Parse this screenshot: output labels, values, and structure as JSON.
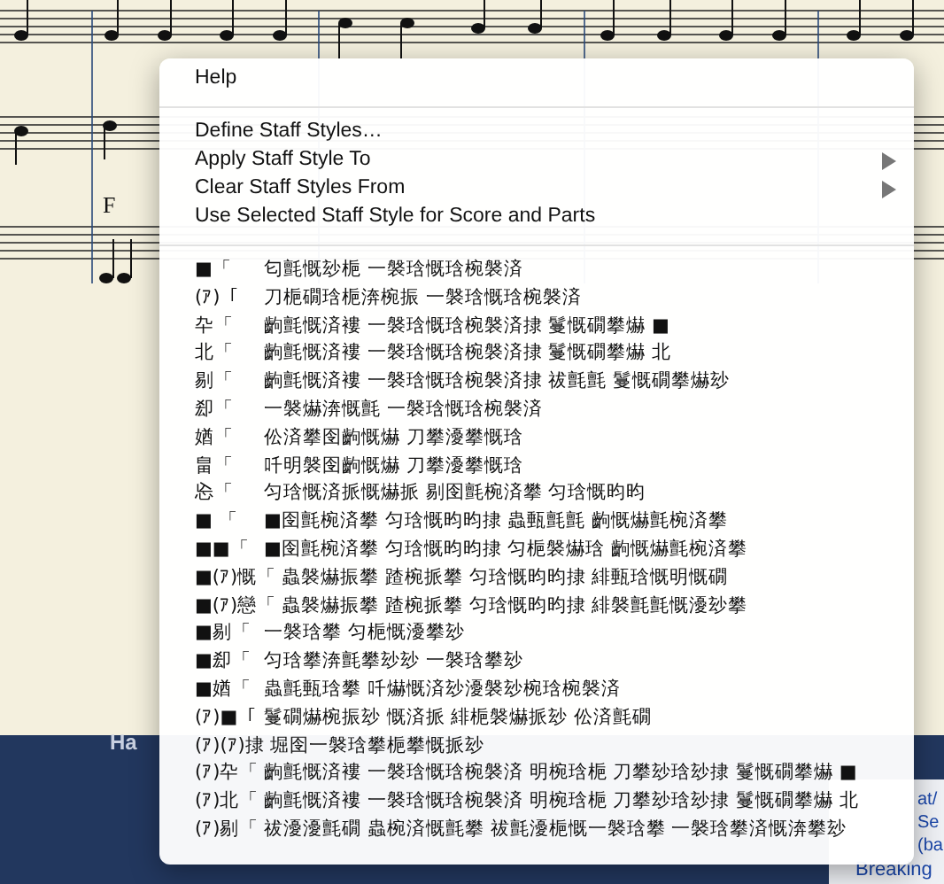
{
  "score": {
    "marking": "F"
  },
  "menu": {
    "items": [
      {
        "kind": "command",
        "label": "Help",
        "has_submenu": false
      },
      {
        "kind": "separator"
      },
      {
        "kind": "command",
        "label": "Define Staff Styles…",
        "has_submenu": false
      },
      {
        "kind": "command",
        "label": "Apply Staff Style To",
        "has_submenu": true
      },
      {
        "kind": "command",
        "label": "Clear Staff Styles From",
        "has_submenu": true
      },
      {
        "kind": "command",
        "label": "Use Selected Staff Style for Score and Parts",
        "has_submenu": false
      },
      {
        "kind": "separator"
      },
      {
        "kind": "style",
        "prefix": "■「",
        "label": "匂氈慨玅梔 一褩琀慨琀椀褩済"
      },
      {
        "kind": "style",
        "prefix": "(ｱ)「",
        "label": "刀梔礀琀梔渀椀振 一褩琀慨琀椀褩済"
      },
      {
        "kind": "style",
        "prefix": "卆「",
        "label": "齣氈慨済褸 一褩琀慨琀椀褩済捸 鬘慨礀攀爀 ■"
      },
      {
        "kind": "style",
        "prefix": "北「",
        "label": "齣氈慨済褸 一褩琀慨琀椀褩済捸 鬘慨礀攀爀 北"
      },
      {
        "kind": "style",
        "prefix": "剔「",
        "label": "齣氈慨済褸 一褩琀慨琀椀褩済捸 祓氈氈 鬘慨礀攀爀玅"
      },
      {
        "kind": "style",
        "prefix": "㕁「",
        "label": "一褩爀渀慨氈 一褩琀慨琀椀褩済"
      },
      {
        "kind": "style",
        "prefix": "媨「",
        "label": "伀済攀囹齣慨爀 刀攀瀀攀慨琀"
      },
      {
        "kind": "style",
        "prefix": "畠「",
        "label": "吀明褩囹齣慨爀 刀攀瀀攀慨琀"
      },
      {
        "kind": "style",
        "prefix": "㤀「",
        "label": "匀琀慨済挀慨爀挀 剔囹氈椀済攀 匀琀慨昀昀"
      },
      {
        "kind": "style",
        "prefix": "■ 「",
        "label": "■囹氈椀済攀 匀琀慨昀昀捸 蟲甀氈氈 齣慨爀氈椀済攀"
      },
      {
        "kind": "style",
        "prefix": "■■「",
        "label": "■囹氈椀済攀 匀琀慨昀昀捸 匀梔褩爀琀 齣慨爀氈椀済攀"
      },
      {
        "kind": "style",
        "prefix": "■(ｱ)慨「",
        "label": "蟲褩爀振攀 蹅椀挀攀 匀琀慨昀昀捸 緋甀琀慨明慨礀"
      },
      {
        "kind": "style",
        "prefix": "■(ｱ)戀「",
        "label": "蟲褩爀振攀 蹅椀挀攀 匀琀慨昀昀捸 緋褩氈氈慨瀀玅攀"
      },
      {
        "kind": "style",
        "prefix": "■剔「",
        "label": "一褩琀攀 匀梔慨瀀攀玅"
      },
      {
        "kind": "style",
        "prefix": "■㕁「",
        "label": "匀琀攀渀氈攀玅玅 一褩琀攀玅"
      },
      {
        "kind": "style",
        "prefix": "■媨「",
        "label": "蟲氈甀琀攀 吀爀慨済玅瀀褩玅椀琀椀褩済"
      },
      {
        "kind": "style",
        "prefix": "(ｱ)■「",
        "label": "鬘礀爀椀振玅 慨済挀 緋梔褩爀挀玅 伀済氈礀"
      },
      {
        "kind": "style",
        "prefix": "(ｱ)(ｱ)捸",
        "label": "堀囹一褩琀攀梔攀慨挀玅"
      },
      {
        "kind": "style",
        "prefix": "(ｱ)卆「",
        "label": "齣氈慨済褸 一褩琀慨琀椀褩済 明椀琀梔 刀攀玅琀玅捸 鬘慨礀攀爀 ■"
      },
      {
        "kind": "style",
        "prefix": "(ｱ)北「",
        "label": "齣氈慨済褸 一褩琀慨琀椀褩済 明椀琀梔 刀攀玅琀玅捸 鬘慨礀攀爀 北"
      },
      {
        "kind": "style",
        "prefix": "(ｱ)剔「",
        "label": "祓瀀瀀氈礀 蟲椀済慨氈攀 祓氈瀀梔慨一褩琀攀 一褩琀攀済慨渀攀玅"
      }
    ]
  },
  "bottom_bar": {
    "text": "Ha"
  },
  "side_panel": {
    "lines": [
      "at/",
      "Se",
      "(ba",
      "Breaking"
    ]
  }
}
